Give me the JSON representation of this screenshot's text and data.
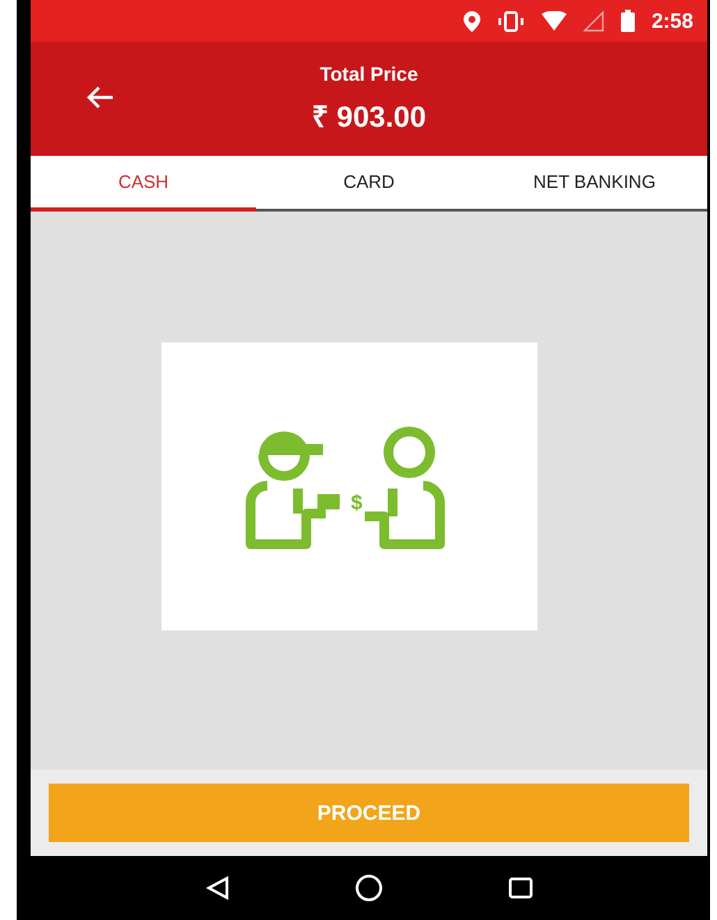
{
  "status_bar": {
    "time": "2:58"
  },
  "app_bar": {
    "title": "Total Price",
    "amount": "₹ 903.00"
  },
  "tabs": [
    {
      "label": "CASH",
      "selected": true
    },
    {
      "label": "CARD",
      "selected": false
    },
    {
      "label": "NET BANKING",
      "selected": false
    }
  ],
  "illustration": {
    "currency_symbol": "$"
  },
  "buttons": [
    {
      "label": "PROCEED"
    }
  ]
}
